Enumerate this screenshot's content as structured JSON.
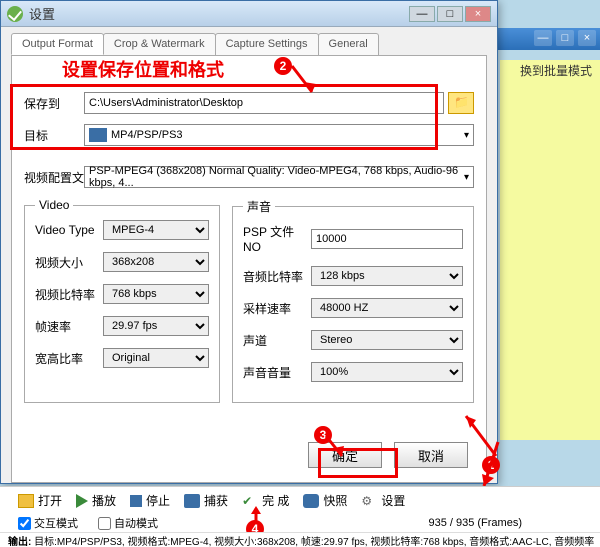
{
  "titlebar": {
    "title": "设置"
  },
  "bg": {
    "mode": "换到批量模式"
  },
  "tabs": [
    "Output Format",
    "Crop & Watermark",
    "Capture Settings",
    "General"
  ],
  "anno": {
    "text": "设置保存位置和格式"
  },
  "save": {
    "label": "保存到",
    "path": "C:\\Users\\Administrator\\Desktop"
  },
  "target": {
    "label": "目标",
    "value": "MP4/PSP/PS3"
  },
  "profile": {
    "label": "视频配置文",
    "value": "PSP-MPEG4 (368x208) Normal Quality: Video-MPEG4, 768 kbps, Audio-96 kbps, 4..."
  },
  "video": {
    "legend": "Video",
    "type_label": "Video Type",
    "type": "MPEG-4",
    "size_label": "视频大小",
    "size": "368x208",
    "bitrate_label": "视频比特率",
    "bitrate": "768 kbps",
    "fps_label": "帧速率",
    "fps": "29.97 fps",
    "aspect_label": "宽高比率",
    "aspect": "Original"
  },
  "audio": {
    "legend": "声音",
    "psp_label": "PSP 文件NO",
    "psp": "10000",
    "abitrate_label": "音频比特率",
    "abitrate": "128 kbps",
    "sample_label": "采样速率",
    "sample": "48000 HZ",
    "channel_label": "声道",
    "channel": "Stereo",
    "volume_label": "声音音量",
    "volume": "100%"
  },
  "btns": {
    "ok": "确定",
    "cancel": "取消"
  },
  "toolbar": {
    "open": "打开",
    "play": "播放",
    "stop": "停止",
    "capture": "捕获",
    "done": "完 成",
    "snap": "快照",
    "settings": "设置"
  },
  "status": {
    "interactive": "交互模式",
    "auto": "自动模式",
    "frames": "935 / 935 (Frames)"
  },
  "output": {
    "label": "输出:",
    "text": "目标:MP4/PSP/PS3, 视频格式:MPEG-4, 视频大小:368x208, 帧速:29.97 fps, 视频比特率:768 kbps, 音频格式:AAC-LC, 音频频率"
  }
}
